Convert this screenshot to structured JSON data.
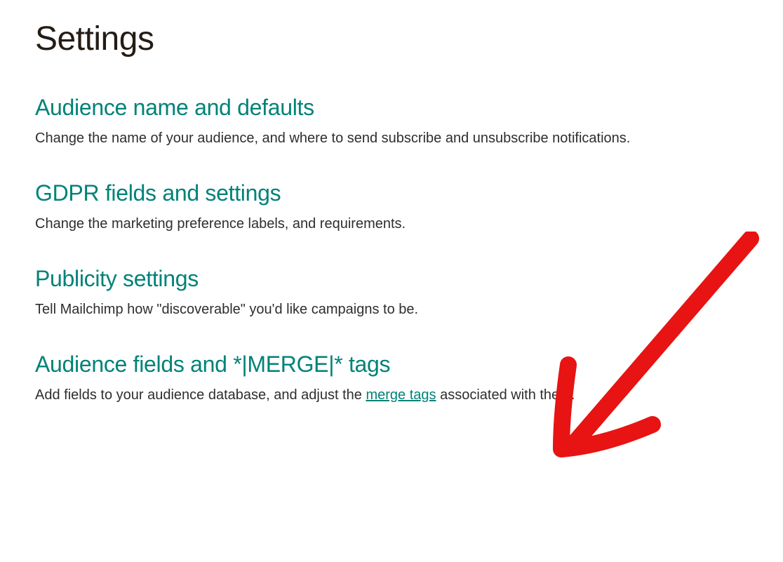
{
  "page": {
    "title": "Settings"
  },
  "sections": [
    {
      "title": "Audience name and defaults",
      "description": "Change the name of your audience, and where to send subscribe and unsubscribe notifications."
    },
    {
      "title": "GDPR fields and settings",
      "description": "Change the marketing preference labels, and requirements."
    },
    {
      "title": "Publicity settings",
      "description": "Tell Mailchimp how \"discoverable\" you'd like campaigns to be."
    },
    {
      "title": "Audience fields and *|MERGE|* tags",
      "description_prefix": "Add fields to your audience database, and adjust the ",
      "description_link": "merge tags",
      "description_suffix": " associated with them."
    }
  ]
}
